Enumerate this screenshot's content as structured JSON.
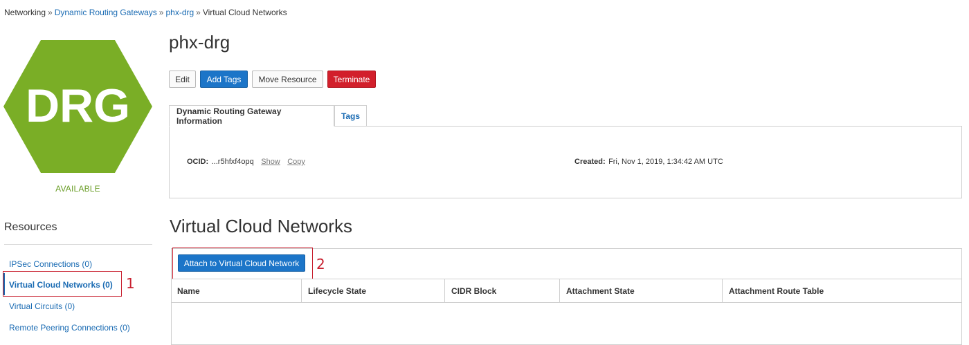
{
  "breadcrumb": {
    "items": [
      "Networking",
      "Dynamic Routing Gateways",
      "phx-drg",
      "Virtual Cloud Networks"
    ],
    "separator": "»"
  },
  "logo": {
    "text": "DRG",
    "color": "#7aae26"
  },
  "status": {
    "text": "AVAILABLE",
    "color": "#6a9d26"
  },
  "resources": {
    "title": "Resources",
    "items": [
      {
        "label": "IPSec Connections (0)"
      },
      {
        "label": "Virtual Cloud Networks (0)",
        "active": true
      },
      {
        "label": "Virtual Circuits (0)"
      },
      {
        "label": "Remote Peering Connections (0)"
      }
    ]
  },
  "page": {
    "title": "phx-drg",
    "buttons": {
      "edit": "Edit",
      "add_tags": "Add Tags",
      "move_resource": "Move Resource",
      "terminate": "Terminate"
    }
  },
  "tabs": {
    "info": "Dynamic Routing Gateway Information",
    "tags": "Tags"
  },
  "info": {
    "ocid_label": "OCID:",
    "ocid_value": "...r5hfxf4opq",
    "show": "Show",
    "copy": "Copy",
    "created_label": "Created:",
    "created_value": "Fri, Nov 1, 2019, 1:34:42 AM UTC"
  },
  "vcn_section": {
    "title": "Virtual Cloud Networks",
    "attach_button": "Attach to Virtual Cloud Network",
    "columns": [
      "Name",
      "Lifecycle State",
      "CIDR Block",
      "Attachment State",
      "Attachment Route Table"
    ]
  },
  "annotations": {
    "one": "1",
    "two": "2"
  },
  "colors": {
    "primary": "#1c75c8",
    "danger": "#d21f2b",
    "link": "#1a6bb3",
    "highlight": "#c8202f"
  }
}
